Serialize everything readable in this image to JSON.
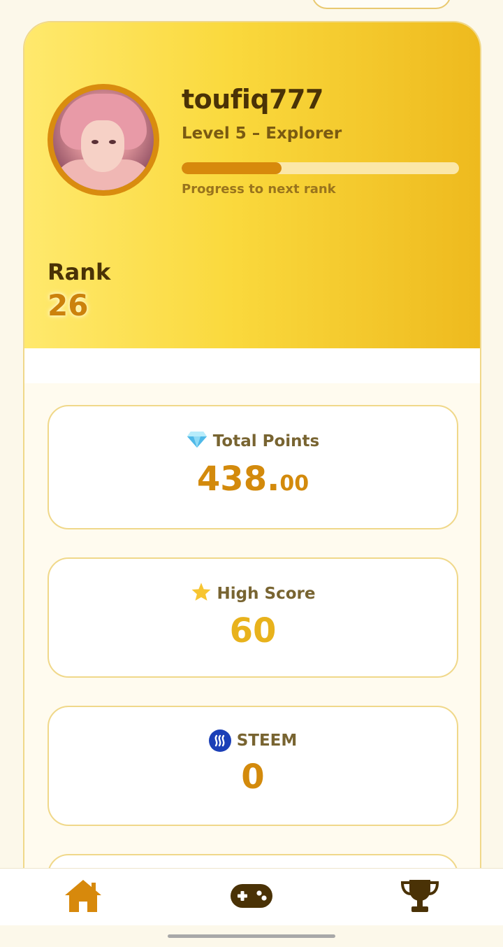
{
  "profile": {
    "username": "toufiq777",
    "level_text": "Level 5 – Explorer",
    "progress_fraction": 0.36,
    "progress_label": "Progress to next rank",
    "rank_label": "Rank",
    "rank_value": "26"
  },
  "stats": [
    {
      "icon": "gem-icon",
      "label": "Total Points",
      "value_int": "438.",
      "value_dec": "00"
    },
    {
      "icon": "star-icon",
      "label": "High Score",
      "value": "60"
    },
    {
      "icon": "steem-icon",
      "label": "STEEM",
      "value": "0"
    }
  ],
  "nav": {
    "items": [
      {
        "icon": "home-icon",
        "active": true
      },
      {
        "icon": "gamepad-icon",
        "active": false
      },
      {
        "icon": "trophy-icon",
        "active": false
      }
    ]
  },
  "colors": {
    "accent": "#d7890c",
    "hero_start": "#ffe96d",
    "hero_end": "#eeba1e",
    "text_dark": "#4a3206",
    "steem_blue": "#1b3fb7"
  }
}
